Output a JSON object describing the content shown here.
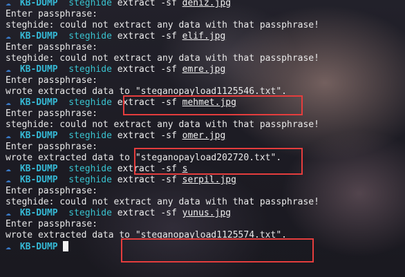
{
  "prompt": {
    "icon": "folder-prompt-icon",
    "host": "KB-DUMP"
  },
  "colors": {
    "host": "#35b8d4",
    "command": "#39c3cf",
    "highlight_box": "#e53d3d",
    "text": "#e9e9e9"
  },
  "lines": [
    {
      "type": "cmd",
      "command": "steghide",
      "args": "extract -sf",
      "file": "deniz.jpg"
    },
    {
      "type": "out",
      "text": "Enter passphrase:"
    },
    {
      "type": "out",
      "text": "steghide: could not extract any data with that passphrase!"
    },
    {
      "type": "cmd",
      "command": "steghide",
      "args": "extract -sf",
      "file": "elif.jpg"
    },
    {
      "type": "out",
      "text": "Enter passphrase:"
    },
    {
      "type": "out",
      "text": "steghide: could not extract any data with that passphrase!"
    },
    {
      "type": "cmd",
      "command": "steghide",
      "args": "extract -sf",
      "file": "emre.jpg"
    },
    {
      "type": "out",
      "text": "Enter passphrase:"
    },
    {
      "type": "out",
      "text": "wrote extracted data to \"steganopayload1125546.txt\"."
    },
    {
      "type": "cmd",
      "command": "steghide",
      "args": "extract -sf",
      "file": "mehmet.jpg"
    },
    {
      "type": "out",
      "text": "Enter passphrase:"
    },
    {
      "type": "out",
      "text": "steghide: could not extract any data with that passphrase!"
    },
    {
      "type": "cmd",
      "command": "steghide",
      "args": "extract -sf",
      "file": "omer.jpg"
    },
    {
      "type": "out",
      "text": "Enter passphrase:"
    },
    {
      "type": "out",
      "text": "wrote extracted data to \"steganopayload202720.txt\"."
    },
    {
      "type": "cmd",
      "command": "steghide",
      "args": "extract -sf",
      "file": "s"
    },
    {
      "type": "cmd",
      "command": "steghide",
      "args": "extract -sf",
      "file": "serpil.jpg"
    },
    {
      "type": "out",
      "text": "Enter passphrase:"
    },
    {
      "type": "out",
      "text": "steghide: could not extract any data with that passphrase!"
    },
    {
      "type": "cmd",
      "command": "steghide",
      "args": "extract -sf",
      "file": "yunus.jpg"
    },
    {
      "type": "out",
      "text": "Enter passphrase:"
    },
    {
      "type": "out",
      "text": "wrote extracted data to \"steganopayload1125574.txt\"."
    },
    {
      "type": "prompt"
    }
  ]
}
